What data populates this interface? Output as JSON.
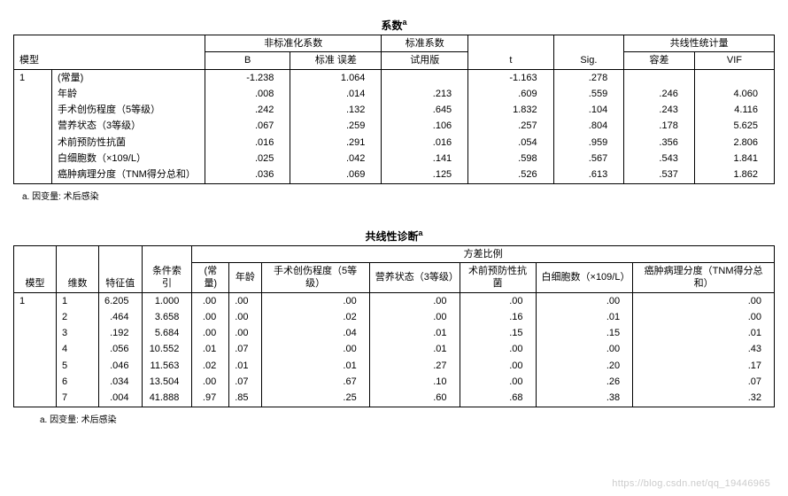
{
  "table1": {
    "title": "系数",
    "title_sup": "a",
    "headers": {
      "model": "模型",
      "unstd_group": "非标准化系数",
      "B": "B",
      "std_err": "标准 误差",
      "std_group": "标准系数",
      "trial": "试用版",
      "t": "t",
      "sig": "Sig.",
      "collin_group": "共线性统计量",
      "tolerance": "容差",
      "vif": "VIF"
    },
    "model_num": "1",
    "rows": [
      {
        "name": "(常量)",
        "B": "-1.238",
        "se": "1.064",
        "beta": "",
        "t": "-1.163",
        "sig": ".278",
        "tol": "",
        "vif": ""
      },
      {
        "name": "年龄",
        "B": ".008",
        "se": ".014",
        "beta": ".213",
        "t": ".609",
        "sig": ".559",
        "tol": ".246",
        "vif": "4.060"
      },
      {
        "name": "手术创伤程度（5等级）",
        "B": ".242",
        "se": ".132",
        "beta": ".645",
        "t": "1.832",
        "sig": ".104",
        "tol": ".243",
        "vif": "4.116"
      },
      {
        "name": "营养状态（3等级）",
        "B": ".067",
        "se": ".259",
        "beta": ".106",
        "t": ".257",
        "sig": ".804",
        "tol": ".178",
        "vif": "5.625"
      },
      {
        "name": "术前预防性抗菌",
        "B": ".016",
        "se": ".291",
        "beta": ".016",
        "t": ".054",
        "sig": ".959",
        "tol": ".356",
        "vif": "2.806"
      },
      {
        "name": "白细胞数（×109/L）",
        "B": ".025",
        "se": ".042",
        "beta": ".141",
        "t": ".598",
        "sig": ".567",
        "tol": ".543",
        "vif": "1.841"
      },
      {
        "name": "癌肿病理分度（TNM得分总和）",
        "B": ".036",
        "se": ".069",
        "beta": ".125",
        "t": ".526",
        "sig": ".613",
        "tol": ".537",
        "vif": "1.862"
      }
    ],
    "footnote": "a. 因变量: 术后感染"
  },
  "table2": {
    "title": "共线性诊断",
    "title_sup": "a",
    "headers": {
      "model": "模型",
      "dim": "维数",
      "eigen": "特征值",
      "cond": "条件索引",
      "varprop_group": "方差比例",
      "const": "(常量)",
      "age": "年龄",
      "trauma": "手术创伤程度（5等级）",
      "nutri": "营养状态（3等级）",
      "preop": "术前预防性抗菌",
      "wbc": "白细胞数（×109/L）",
      "tnm": "癌肿病理分度（TNM得分总和）"
    },
    "model_num": "1",
    "rows": [
      {
        "dim": "1",
        "eigen": "6.205",
        "cond": "1.000",
        "c": ".00",
        "age": ".00",
        "trauma": ".00",
        "nutri": ".00",
        "preop": ".00",
        "wbc": ".00",
        "tnm": ".00"
      },
      {
        "dim": "2",
        "eigen": ".464",
        "cond": "3.658",
        "c": ".00",
        "age": ".00",
        "trauma": ".02",
        "nutri": ".00",
        "preop": ".16",
        "wbc": ".01",
        "tnm": ".00"
      },
      {
        "dim": "3",
        "eigen": ".192",
        "cond": "5.684",
        "c": ".00",
        "age": ".00",
        "trauma": ".04",
        "nutri": ".01",
        "preop": ".15",
        "wbc": ".15",
        "tnm": ".01"
      },
      {
        "dim": "4",
        "eigen": ".056",
        "cond": "10.552",
        "c": ".01",
        "age": ".07",
        "trauma": ".00",
        "nutri": ".01",
        "preop": ".00",
        "wbc": ".00",
        "tnm": ".43"
      },
      {
        "dim": "5",
        "eigen": ".046",
        "cond": "11.563",
        "c": ".02",
        "age": ".01",
        "trauma": ".01",
        "nutri": ".27",
        "preop": ".00",
        "wbc": ".20",
        "tnm": ".17"
      },
      {
        "dim": "6",
        "eigen": ".034",
        "cond": "13.504",
        "c": ".00",
        "age": ".07",
        "trauma": ".67",
        "nutri": ".10",
        "preop": ".00",
        "wbc": ".26",
        "tnm": ".07"
      },
      {
        "dim": "7",
        "eigen": ".004",
        "cond": "41.888",
        "c": ".97",
        "age": ".85",
        "trauma": ".25",
        "nutri": ".60",
        "preop": ".68",
        "wbc": ".38",
        "tnm": ".32"
      }
    ],
    "footnote": "a. 因变量: 术后感染"
  },
  "watermark": "https://blog.csdn.net/qq_19446965"
}
